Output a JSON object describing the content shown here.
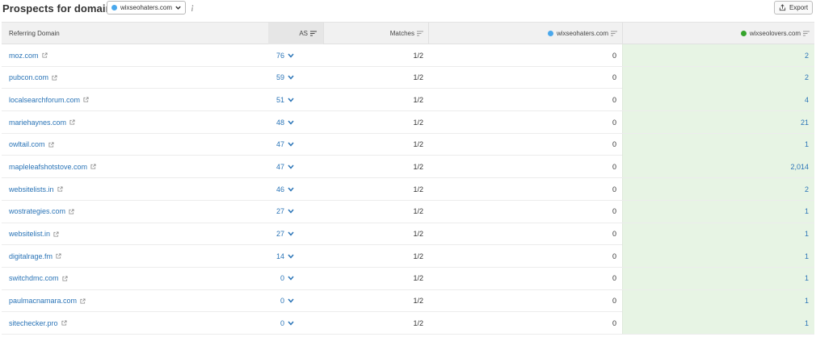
{
  "header": {
    "title": "Prospects for domain:",
    "selected_domain": "wixseohaters.com",
    "export_label": "Export"
  },
  "table": {
    "columns": {
      "domain": "Referring Domain",
      "as": "AS",
      "matches": "Matches",
      "own": "wixseohaters.com",
      "competitor": "wixseolovers.com"
    },
    "rows": [
      {
        "domain": "moz.com",
        "as": "76",
        "matches": "1/2",
        "own": "0",
        "competitor": "2"
      },
      {
        "domain": "pubcon.com",
        "as": "59",
        "matches": "1/2",
        "own": "0",
        "competitor": "2"
      },
      {
        "domain": "localsearchforum.com",
        "as": "51",
        "matches": "1/2",
        "own": "0",
        "competitor": "4"
      },
      {
        "domain": "mariehaynes.com",
        "as": "48",
        "matches": "1/2",
        "own": "0",
        "competitor": "21"
      },
      {
        "domain": "owltail.com",
        "as": "47",
        "matches": "1/2",
        "own": "0",
        "competitor": "1"
      },
      {
        "domain": "mapleleafshotstove.com",
        "as": "47",
        "matches": "1/2",
        "own": "0",
        "competitor": "2,014"
      },
      {
        "domain": "websitelists.in",
        "as": "46",
        "matches": "1/2",
        "own": "0",
        "competitor": "2"
      },
      {
        "domain": "wostrategies.com",
        "as": "27",
        "matches": "1/2",
        "own": "0",
        "competitor": "1"
      },
      {
        "domain": "websitelist.in",
        "as": "27",
        "matches": "1/2",
        "own": "0",
        "competitor": "1"
      },
      {
        "domain": "digitalrage.fm",
        "as": "14",
        "matches": "1/2",
        "own": "0",
        "competitor": "1"
      },
      {
        "domain": "switchdmc.com",
        "as": "0",
        "matches": "1/2",
        "own": "0",
        "competitor": "1"
      },
      {
        "domain": "paulmacnamara.com",
        "as": "0",
        "matches": "1/2",
        "own": "0",
        "competitor": "1"
      },
      {
        "domain": "sitechecker.pro",
        "as": "0",
        "matches": "1/2",
        "own": "0",
        "competitor": "1"
      }
    ]
  },
  "colors": {
    "link": "#2a74b7",
    "own_dot": "#4aa8ec",
    "competitor_dot": "#35a42c",
    "competitor_bg": "#e7f4e4"
  },
  "icons": {
    "sort": "sort-icon",
    "external": "external-link-icon",
    "dropdown": "chevron-down-icon",
    "export": "export-icon"
  }
}
